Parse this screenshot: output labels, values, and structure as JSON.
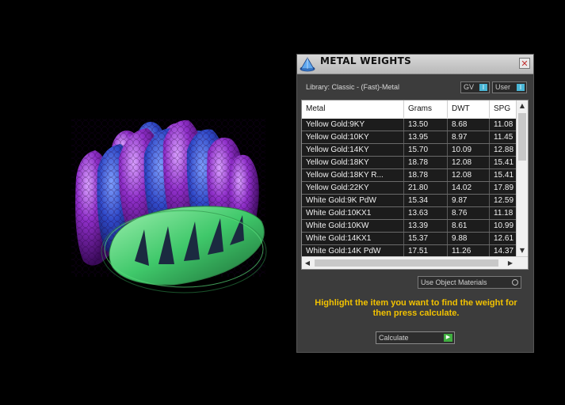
{
  "panel": {
    "title": "METAL WEIGHTS",
    "close_glyph": "✕",
    "library_label": "Library: Classic - (Fast)-Metal",
    "gv_label": "GV",
    "user_label": "User",
    "toggle_glyph": "I",
    "use_object_materials_label": "Use Object Materials",
    "hint_text": "Highlight the item you want to find the weight for then press calculate.",
    "calculate_label": "Calculate",
    "calculate_glyph": "▶"
  },
  "table": {
    "columns": [
      "Metal",
      "Grams",
      "DWT",
      "SPG"
    ],
    "rows": [
      [
        "Yellow Gold:9KY",
        "13.50",
        "8.68",
        "11.08"
      ],
      [
        "Yellow Gold:10KY",
        "13.95",
        "8.97",
        "11.45"
      ],
      [
        "Yellow Gold:14KY",
        "15.70",
        "10.09",
        "12.88"
      ],
      [
        "Yellow Gold:18KY",
        "18.78",
        "12.08",
        "15.41"
      ],
      [
        "Yellow Gold:18KY R...",
        "18.78",
        "12.08",
        "15.41"
      ],
      [
        "Yellow Gold:22KY",
        "21.80",
        "14.02",
        "17.89"
      ],
      [
        "White Gold:9K PdW",
        "15.34",
        "9.87",
        "12.59"
      ],
      [
        "White Gold:10KX1",
        "13.63",
        "8.76",
        "11.18"
      ],
      [
        "White Gold:10KW",
        "13.39",
        "8.61",
        "10.99"
      ],
      [
        "White Gold:14KX1",
        "15.37",
        "9.88",
        "12.61"
      ],
      [
        "White Gold:14K PdW",
        "17.51",
        "11.26",
        "14.37"
      ]
    ],
    "scroll_up": "▲",
    "scroll_down": "▼",
    "scroll_left": "◀",
    "scroll_right": "▶"
  },
  "icons": {
    "app": "cone-icon"
  },
  "colors": {
    "hint": "#f2c200",
    "ring_purple": "#8e2ec8",
    "ring_blue": "#2f49c8",
    "ring_green": "#3fc86a"
  }
}
